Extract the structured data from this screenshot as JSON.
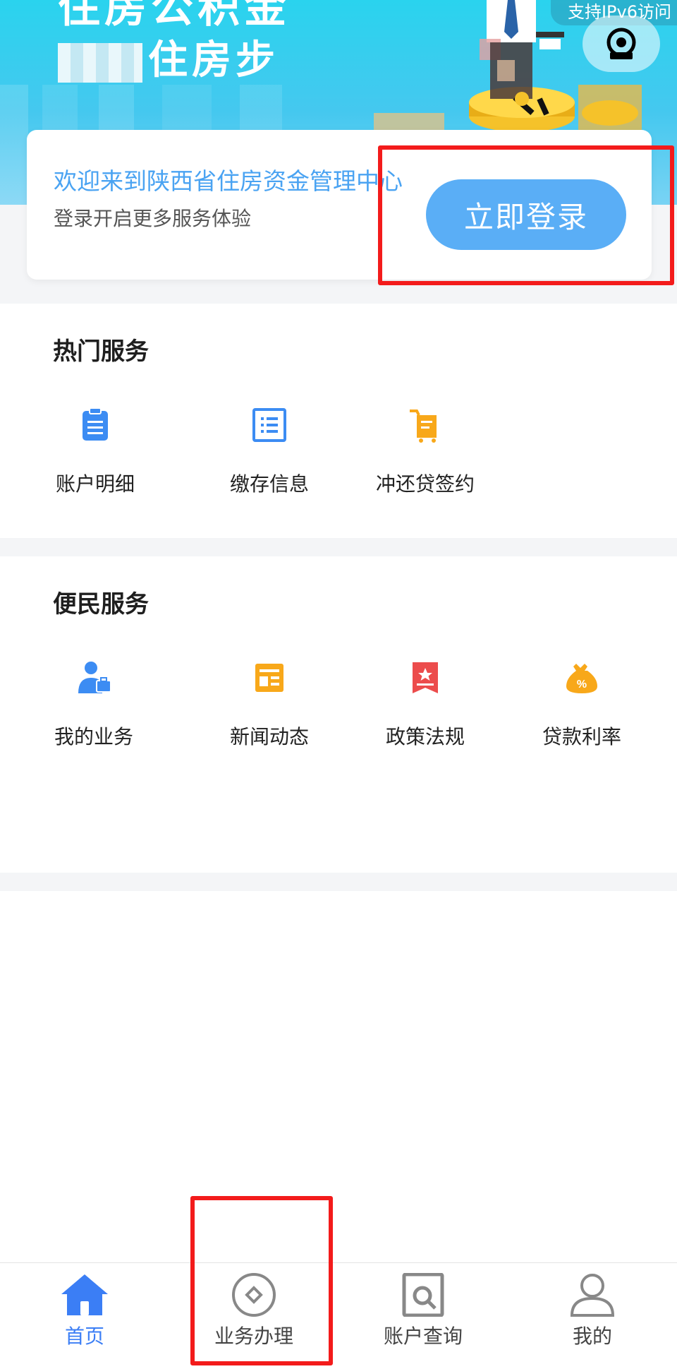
{
  "banner": {
    "title": "住房公积金",
    "subtitle_suffix": "住房步",
    "ipv6_label": "支持IPv6访问"
  },
  "login_card": {
    "welcome": "欢迎来到陕西省住房资金管理中心",
    "tip": "登录开启更多服务体验",
    "login_button": "立即登录"
  },
  "hot_services": {
    "title": "热门服务",
    "items": [
      {
        "label": "账户明细",
        "icon": "clipboard-icon"
      },
      {
        "label": "缴存信息",
        "icon": "list-doc-icon"
      },
      {
        "label": "冲还贷签约",
        "icon": "cart-doc-icon"
      }
    ]
  },
  "convenience_services": {
    "title": "便民服务",
    "items": [
      {
        "label": "我的业务",
        "icon": "person-briefcase-icon"
      },
      {
        "label": "新闻动态",
        "icon": "news-icon"
      },
      {
        "label": "政策法规",
        "icon": "bookmark-star-icon"
      },
      {
        "label": "贷款利率",
        "icon": "money-bag-percent-icon"
      }
    ]
  },
  "tabbar": {
    "items": [
      {
        "label": "首页",
        "icon": "home-icon",
        "active": true
      },
      {
        "label": "业务办理",
        "icon": "compass-icon",
        "active": false
      },
      {
        "label": "账户查询",
        "icon": "search-doc-icon",
        "active": false
      },
      {
        "label": "我的",
        "icon": "user-icon",
        "active": false
      }
    ]
  },
  "colors": {
    "accent": "#3b7ef5",
    "login_button": "#5aaef6",
    "welcome_text": "#4aa3f2",
    "highlight_box": "#f31b1b",
    "icon_blue": "#3c8cf3",
    "icon_orange": "#f8a81a",
    "icon_red": "#ec4c4c"
  }
}
